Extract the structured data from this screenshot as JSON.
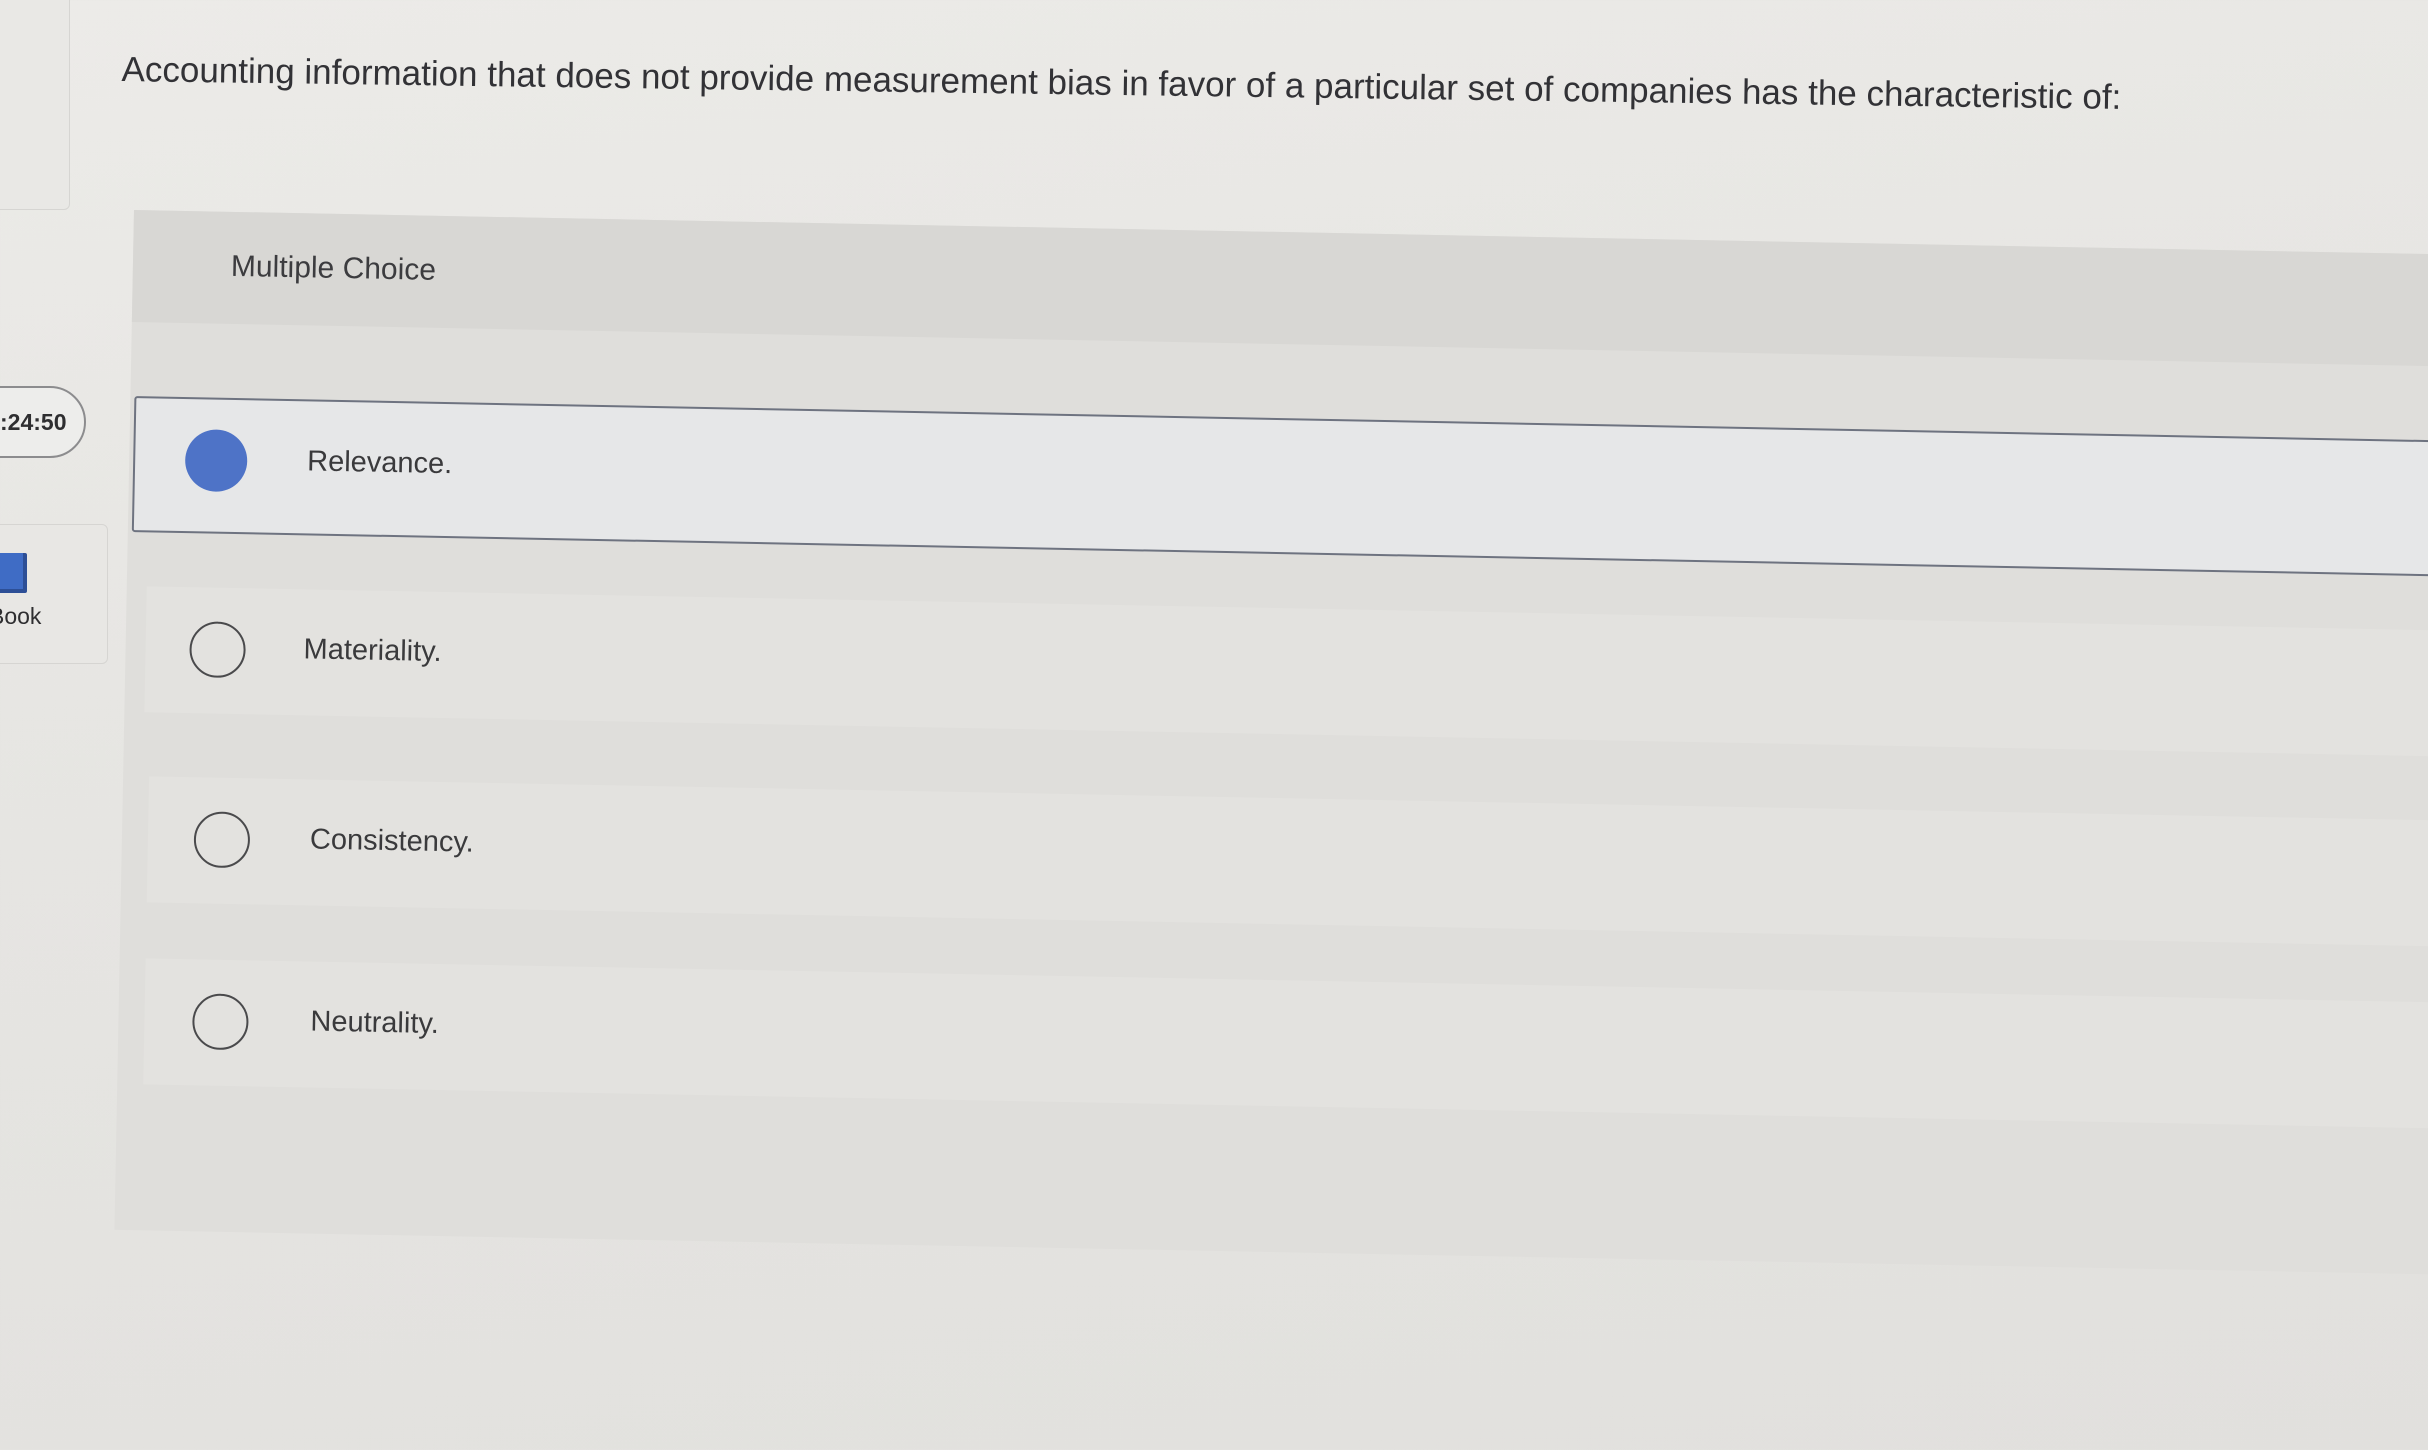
{
  "question": {
    "text": "Accounting information that does not provide measurement bias in favor of a particular set of companies has the characteristic of:"
  },
  "sidebar": {
    "timer": ":24:50",
    "ebook_label": "Book"
  },
  "multiple_choice": {
    "label": "Multiple Choice",
    "selected_index": 0,
    "options": [
      {
        "label": "Relevance.",
        "selected": true
      },
      {
        "label": "Materiality.",
        "selected": false
      },
      {
        "label": "Consistency.",
        "selected": false
      },
      {
        "label": "Neutrality.",
        "selected": false
      }
    ]
  },
  "colors": {
    "accent": "#4e73c7",
    "background": "#e6e5e2"
  }
}
